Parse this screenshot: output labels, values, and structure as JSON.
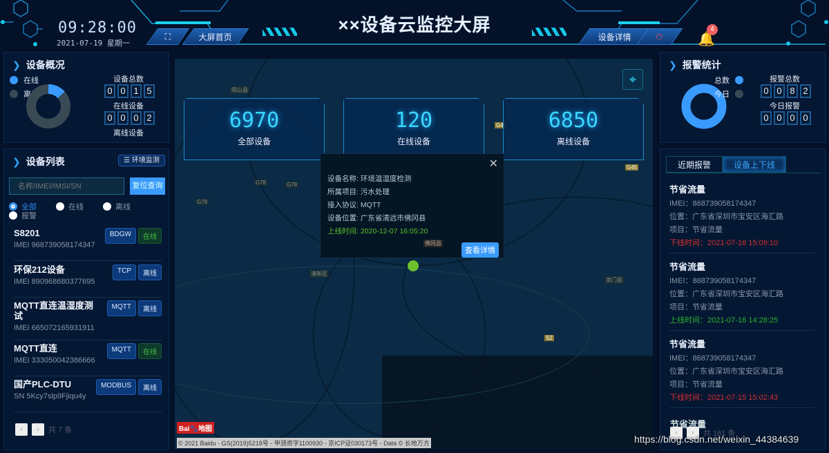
{
  "header": {
    "title": "××设备云监控大屏",
    "time": "09:28:00",
    "date": "2021-07-19  星期一",
    "home_label": "大屏首页",
    "detail_label": "设备详情",
    "notification_count": "4",
    "icons": [
      "fullscreen-icon",
      "power-icon",
      "bell-icon"
    ]
  },
  "overview": {
    "title": "设备概况",
    "legend_online": "在线",
    "legend_offline": "离线",
    "total_label": "设备总数",
    "total_digits": [
      "0",
      "0",
      "1",
      "5"
    ],
    "online_label": "在线设备",
    "online_digits": [
      "0",
      "0",
      "0",
      "2"
    ],
    "offline_label": "离线设备",
    "online_fraction": 0.133,
    "colors": {
      "online": "#3a9bff",
      "offline": "#3a4a55"
    }
  },
  "device_list": {
    "title": "设备列表",
    "env_button": "环境监测",
    "search_placeholder": "名称/IMEI/IMSI/SN",
    "reset_button": "复位查询",
    "filters": [
      "全部",
      "在线",
      "离线",
      "报警"
    ],
    "items": [
      {
        "name": "S8201",
        "id": "IMEI 968739058174347",
        "protocol": "BDGW",
        "status": "在线"
      },
      {
        "name": "环保212设备",
        "id": "IMEI 890968680377695",
        "protocol": "TCP",
        "status": "离线"
      },
      {
        "name": "MQTT直连温湿度测试",
        "id": "IMEI 665072165931911",
        "protocol": "MQTT",
        "status": "离线"
      },
      {
        "name": "MQTT直连",
        "id": "IMEI 333050042386666",
        "protocol": "MQTT",
        "status": "在线"
      },
      {
        "name": "国产PLC-DTU",
        "id": "SN 5Kcy7slp9Fjiqu4y",
        "protocol": "MODBUS",
        "status": "离线"
      }
    ],
    "total": "共 7 条"
  },
  "map": {
    "stats": [
      {
        "value": "6970",
        "label": "全部设备"
      },
      {
        "value": "120",
        "label": "在线设备"
      },
      {
        "value": "6850",
        "label": "离线设备"
      }
    ],
    "popup": {
      "name": "设备名称:  环境温湿度检测",
      "project": "所属项目:  污水处理",
      "protocol": "接入协议:  MQTT",
      "location": "设备位置:  广东省清远市佛冈县",
      "time": "上线时间:  2020-12-07 16:05:20",
      "button": "查看详情"
    },
    "labels": {
      "a": "阳山县",
      "b": "G78",
      "c": "G78",
      "d": "G78",
      "e": "G4",
      "f": "G45",
      "g": "佛冈县",
      "h": "清新区",
      "i": "S2",
      "j": "龙门县"
    },
    "copyright": "© 2021 Baidu - GS(2019)5218号 - 甲测资字1100930 - 京ICP证030173号 - Data © 长地万方",
    "logo": "Bai du 地图"
  },
  "alarm_stats": {
    "title": "报警统计",
    "legend_total": "总数",
    "legend_today": "今日",
    "total_label": "报警总数",
    "total_digits": [
      "0",
      "0",
      "8",
      "2"
    ],
    "today_label": "今日报警",
    "today_digits": [
      "0",
      "0",
      "0",
      "0"
    ]
  },
  "records": {
    "tabs": [
      "近期报警",
      "设备上下线"
    ],
    "items": [
      {
        "title": "节省流量",
        "imei": "IMEI：868739058174347",
        "location": "位置：广东省深圳市宝安区海汇路",
        "project": "项目：节省流量",
        "time": "下线时间：2021-07-16 15:09:10",
        "type": "off"
      },
      {
        "title": "节省流量",
        "imei": "IMEI：868739058174347",
        "location": "位置：广东省深圳市宝安区海汇路",
        "project": "项目：节省流量",
        "time": "上线时间：2021-07-16 14:28:25",
        "type": "on"
      },
      {
        "title": "节省流量",
        "imei": "IMEI：868739058174347",
        "location": "位置：广东省深圳市宝安区海汇路",
        "project": "项目：节省流量",
        "time": "下线时间：2021-07-15 15:02:43",
        "type": "off"
      }
    ],
    "partial_title": "节省流量",
    "total": "共 161 条"
  },
  "watermark": "https://blog.csdn.net/weixin_44384639"
}
